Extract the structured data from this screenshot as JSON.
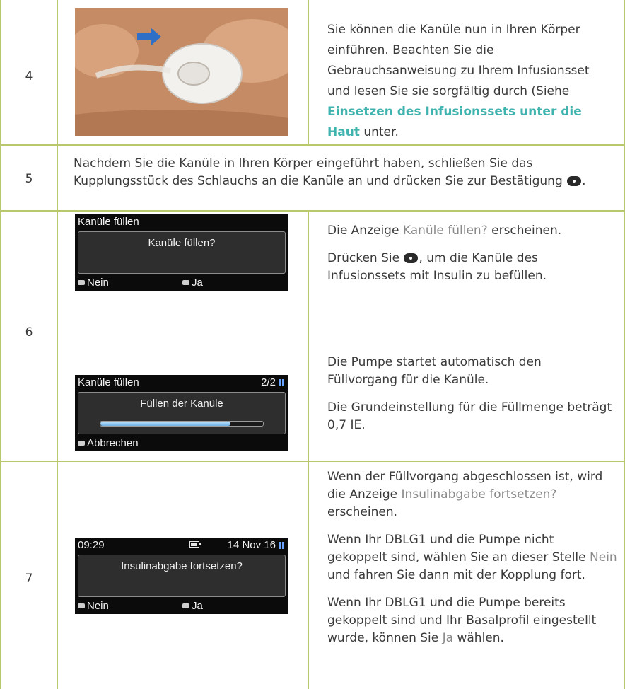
{
  "rows": [
    {
      "step": "4",
      "text_parts": {
        "before": "Sie können die Kanüle nun in Ihren Körper einführen. Beachten Sie die Gebrauchsanweisung zu Ihrem Infusionsset und lesen Sie sie sorgfältig durch (Siehe ",
        "link": "Einsetzen des Infusionssets unter die Haut",
        "after": " unter."
      }
    },
    {
      "step": "5",
      "text": "Nachdem Sie die Kanüle in Ihren Körper eingeführt haben, schließen Sie das Kupplungsstück des Schlauchs an die Kanüle an und drücken Sie zur Bestätigung",
      "end": "."
    },
    {
      "step": "6",
      "p1_before": "Die Anzeige ",
      "p1_term": "Kanüle füllen?",
      "p1_after": " erscheinen.",
      "p2_before": "Drücken Sie ",
      "p2_after": ", um die Kanüle des Infusionssets mit Insulin zu befüllen.",
      "p3": "Die Pumpe startet automatisch den Füllvorgang für die Kanüle.",
      "p4": "Die Grundeinstellung für die Füllmenge beträgt 0,7 IE.",
      "screen1": {
        "header": "Kanüle füllen",
        "message": "Kanüle füllen?",
        "left_soft": "Nein",
        "right_soft": "Ja"
      },
      "screen2": {
        "header": "Kanüle füllen",
        "page": "2/2",
        "message": "Füllen der Kanüle",
        "progress": 0.8,
        "left_soft": "Abbrechen"
      }
    },
    {
      "step": "7",
      "p1_before": "Wenn der Füllvorgang abgeschlossen ist, wird die Anzeige ",
      "p1_term": "Insulinabgabe fortsetzen?",
      "p1_after": " erscheinen.",
      "p2_before": "Wenn Ihr DBLG1 und die Pumpe nicht gekoppelt sind, wählen Sie an dieser Stelle ",
      "p2_term": "Nein",
      "p2_after": " und fahren Sie dann mit der Kopplung fort.",
      "p3_before": "Wenn Ihr DBLG1 und die Pumpe bereits gekoppelt sind und Ihr Basalprofil eingestellt wurde, können Sie ",
      "p3_term": "Ja",
      "p3_after": " wählen.",
      "screen": {
        "time": "09:29",
        "date": "14 Nov 16",
        "message": "Insulinabgabe fortsetzen?",
        "left_soft": "Nein",
        "right_soft": "Ja"
      }
    }
  ],
  "icons": {
    "ok_button": "ok-button-icon",
    "arrow": "arrow-icon"
  },
  "colors": {
    "border": "#b7c96a",
    "link": "#3fb3ad",
    "term": "#8a8a8a",
    "progress": "#6fb2e6"
  }
}
